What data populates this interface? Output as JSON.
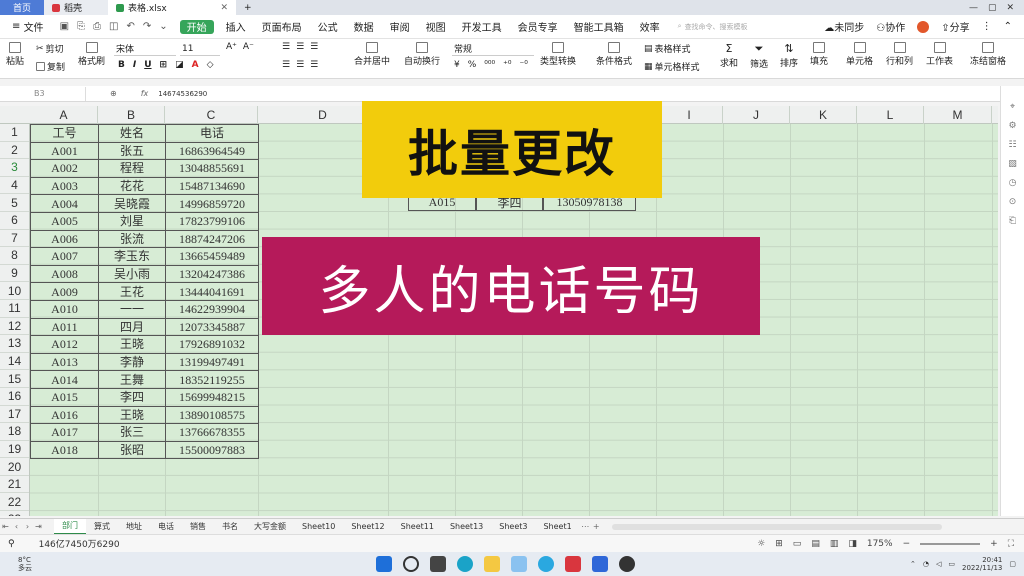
{
  "tabs": {
    "home": "首页",
    "doc": "稻壳",
    "active": "表格.xlsx",
    "new": "+"
  },
  "menu": {
    "file": "文件",
    "items": [
      "开始",
      "插入",
      "页面布局",
      "公式",
      "数据",
      "审阅",
      "视图",
      "开发工具",
      "会员专享",
      "智能工具箱",
      "效率"
    ],
    "search_placeholder": "查找命令、搜索模板",
    "unsynced": "未同步",
    "collab": "协作",
    "share": "分享"
  },
  "ribbon": {
    "paste": "粘贴",
    "cut": "剪切",
    "copy": "复制",
    "format_painter": "格式刷",
    "font": "宋体",
    "size": "11",
    "merge": "合并居中",
    "wrap": "自动换行",
    "number_format": "常规",
    "type_convert": "类型转换",
    "cond_format": "条件格式",
    "table_style": "表格样式",
    "cell_style": "单元格样式",
    "sum": "求和",
    "filter": "筛选",
    "sort": "排序",
    "fill": "填充",
    "cell": "单元格",
    "rowcol": "行和列",
    "worksheet": "工作表",
    "freeze": "冻结窗格",
    "fmt_buttons": [
      "B",
      "I",
      "U",
      "A",
      "A"
    ]
  },
  "formula": {
    "namebox": "B3",
    "fx": "fx",
    "value": "14674536290"
  },
  "columns": [
    "A",
    "B",
    "C",
    "D",
    "E",
    "F",
    "G",
    "H",
    "I",
    "J",
    "K",
    "L",
    "M"
  ],
  "rows": [
    "1",
    "2",
    "3",
    "4",
    "5",
    "6",
    "7",
    "8",
    "9",
    "10",
    "11",
    "12",
    "13",
    "14",
    "15",
    "16",
    "17",
    "18",
    "19",
    "20",
    "21",
    "22",
    "23"
  ],
  "table": [
    [
      "工号",
      "姓名",
      "电话"
    ],
    [
      "A001",
      "张五",
      "16863964549"
    ],
    [
      "A002",
      "程程",
      "13048855691"
    ],
    [
      "A003",
      "花花",
      "15487134690"
    ],
    [
      "A004",
      "吴晓霞",
      "14996859720"
    ],
    [
      "A005",
      "刘星",
      "17823799106"
    ],
    [
      "A006",
      "张流",
      "18874247206"
    ],
    [
      "A007",
      "李玉东",
      "13665459489"
    ],
    [
      "A008",
      "吴小雨",
      "13204247386"
    ],
    [
      "A009",
      "王花",
      "13444041691"
    ],
    [
      "A010",
      "一一",
      "14622939904"
    ],
    [
      "A011",
      "四月",
      "12073345887"
    ],
    [
      "A012",
      "王晓",
      "17926891032"
    ],
    [
      "A013",
      "李静",
      "13199497491"
    ],
    [
      "A014",
      "王舞",
      "18352119255"
    ],
    [
      "A015",
      "李四",
      "15699948215"
    ],
    [
      "A016",
      "王晓",
      "13890108575"
    ],
    [
      "A017",
      "张三",
      "13766678355"
    ],
    [
      "A018",
      "张昭",
      "15500097883"
    ]
  ],
  "partial_row": [
    "A015",
    "李四",
    "13050978138"
  ],
  "banners": {
    "top": "批量更改",
    "bottom": "多人的电话号码"
  },
  "sheets": [
    "部门",
    "算式",
    "地址",
    "电话",
    "销售",
    "书名",
    "大写金额",
    "Sheet10",
    "Sheet12",
    "Sheet11",
    "Sheet13",
    "Sheet3",
    "Sheet1"
  ],
  "status": {
    "sum": "146亿7450万6290",
    "zoom": "175%"
  },
  "taskbar": {
    "temp": "8°C",
    "weather": "多云",
    "time": "20:41",
    "date": "2022/11/13"
  },
  "colors": {
    "grid_bg": "#d7ecd5",
    "banner_yellow": "#f2cc0c",
    "banner_magenta": "#b51a5a",
    "accent_green": "#36a55a"
  }
}
